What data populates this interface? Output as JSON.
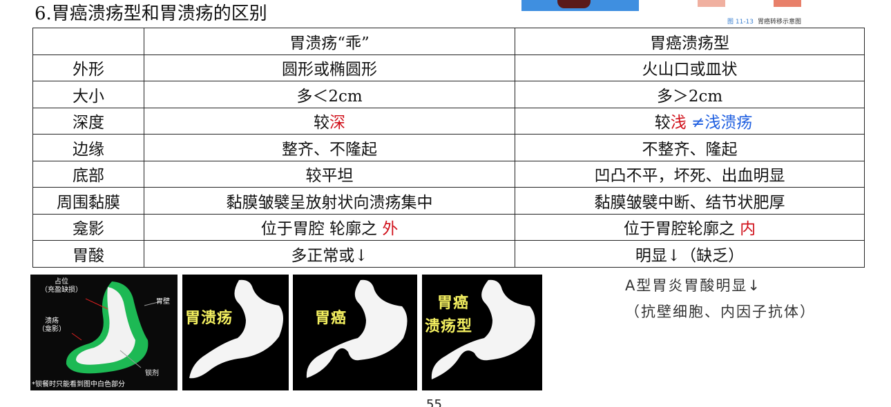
{
  "heading": "6.胃癌溃疡型和胃溃疡的区别",
  "figure_caption": {
    "number": "图 11-13",
    "text": "胃癌转移示意图"
  },
  "table": {
    "headers": [
      "",
      "胃溃疡“乖”",
      "胃癌溃疡型"
    ],
    "rows": [
      {
        "label": "外形",
        "ulcer": "圆形或椭圆形",
        "cancer": "火山口或皿状"
      },
      {
        "label": "大小",
        "ulcer": "多＜2cm",
        "cancer": "多＞2cm"
      },
      {
        "label": "深度",
        "ulcer_prefix": "较",
        "ulcer_hl": "深",
        "cancer_prefix": "较",
        "cancer_hl": "浅",
        "cancer_note": "≠浅溃疡"
      },
      {
        "label": "边缘",
        "ulcer": "整齐、不隆起",
        "cancer": "不整齐、隆起"
      },
      {
        "label": "底部",
        "ulcer": "较平坦",
        "cancer": "凹凸不平，坏死、出血明显"
      },
      {
        "label": "周围黏膜",
        "ulcer": "黏膜皱襞呈放射状向溃疡集中",
        "cancer": "黏膜皱襞中断、结节状肥厚"
      },
      {
        "label": "龛影",
        "ulcer_prefix": "位于胃腔 轮廓之 ",
        "ulcer_hl": "外",
        "cancer_prefix": "位于胃腔轮廓之 ",
        "cancer_hl": "内"
      },
      {
        "label": "胃酸",
        "ulcer": "多正常或↓",
        "cancer": "明显↓（缺乏）"
      }
    ]
  },
  "diagram_labels": {
    "filling_defect": "占位\n（充盈缺损）",
    "ulcer_niche": "溃疡\n（龛影）",
    "stomach_wall": "胃壁",
    "barium": "钡剂",
    "footnote": "*钡餐时只能看到图中白色部分"
  },
  "panel_labels": {
    "ulcer": "胃溃疡",
    "cancer": "胃癌",
    "ulcerative_cancer_line1": "胃癌",
    "ulcerative_cancer_line2": "溃疡型"
  },
  "notes": {
    "line1": "A型胃炎胃酸明显↓",
    "line2": "（抗壁细胞、内因子抗体）"
  },
  "page_number": "55",
  "colors": {
    "highlight_red": "#d0101a",
    "highlight_blue": "#1f5fe0",
    "handwriting_yellow": "#f4f060",
    "wall_green": "#1db954"
  }
}
